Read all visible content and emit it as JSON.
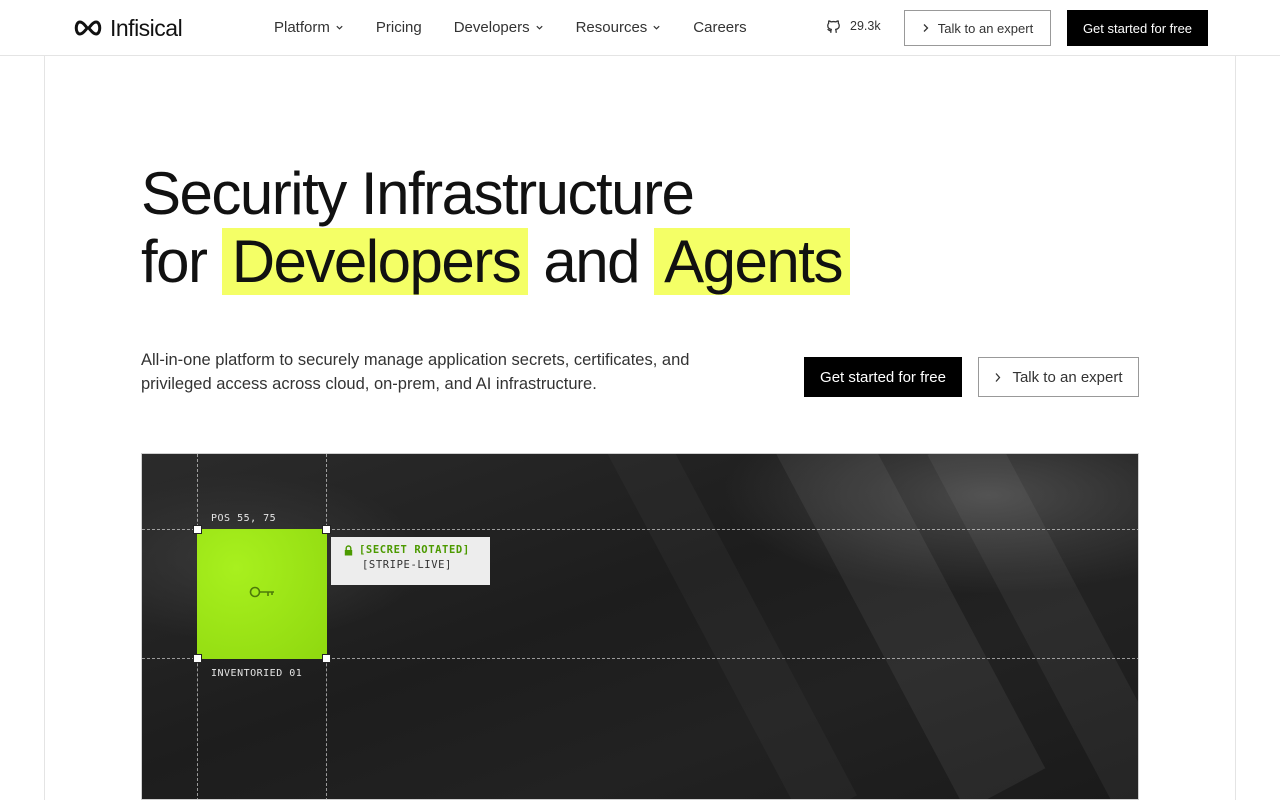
{
  "header": {
    "brand": "Infisical",
    "nav": [
      {
        "label": "Platform",
        "dropdown": true
      },
      {
        "label": "Pricing",
        "dropdown": false
      },
      {
        "label": "Developers",
        "dropdown": true
      },
      {
        "label": "Resources",
        "dropdown": true
      },
      {
        "label": "Careers",
        "dropdown": false
      }
    ],
    "github_stars": "29.3k",
    "talk_label": "Talk to an expert",
    "cta_label": "Get started for free"
  },
  "hero": {
    "title_line1": "Security Infrastructure",
    "title_for": "for",
    "title_hl1": "Developers",
    "title_and": "and",
    "title_hl2": "Agents",
    "subtitle": "All-in-one platform to securely manage application secrets, certificates, and privileged access across cloud, on-prem, and AI infrastructure.",
    "cta_primary": "Get started for free",
    "cta_secondary": "Talk to an expert"
  },
  "visual": {
    "pos_label": "POS 55, 75",
    "inventory_label": "INVENTORIED 01",
    "tooltip_status": "[SECRET ROTATED]",
    "tooltip_name": "[STRIPE-LIVE]",
    "accent_color": "#9ceb15",
    "highlight_color": "#f4ff66"
  }
}
